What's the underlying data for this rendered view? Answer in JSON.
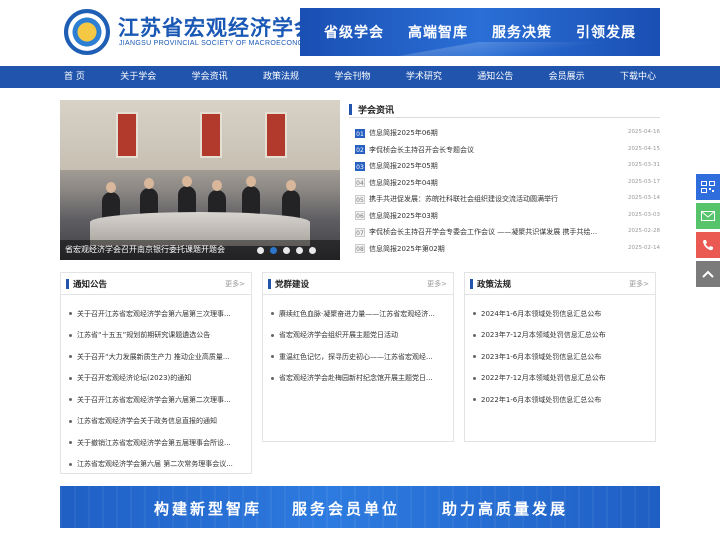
{
  "header": {
    "site_title": "江苏省宏观经济学会",
    "site_subtitle": "JIANGSU PROVINCIAL SOCIETY OF MACROECONOMICS",
    "emblem_text": "江苏省宏观经济学会",
    "slogans": [
      "省级学会",
      "高端智库",
      "服务决策",
      "引领发展"
    ]
  },
  "nav": {
    "items": [
      "首 页",
      "关于学会",
      "学会资讯",
      "政策法规",
      "学会刊物",
      "学术研究",
      "通知公告",
      "会员展示",
      "下载中心"
    ],
    "active_index": 0
  },
  "slider": {
    "caption": "省宏观经济学会召开南京银行委托课题开题会",
    "dot_count": 5,
    "active_dot": 1
  },
  "news": {
    "title": "学会资讯",
    "items": [
      {
        "num": "01",
        "text": "信息简报2025年06期",
        "date": "2025-04-16",
        "hot": true
      },
      {
        "num": "02",
        "text": "李侃桢会长主持召开会长专题会议",
        "date": "2025-04-15",
        "hot": true
      },
      {
        "num": "03",
        "text": "信息简报2025年05期",
        "date": "2025-03-31",
        "hot": true
      },
      {
        "num": "04",
        "text": "信息简报2025年04期",
        "date": "2025-03-17",
        "hot": false
      },
      {
        "num": "05",
        "text": "携手共进促发展：苏皖社科联社会组织建设交流活动圆满举行",
        "date": "2025-03-14",
        "hot": false
      },
      {
        "num": "06",
        "text": "信息简报2025年03期",
        "date": "2025-03-03",
        "hot": false
      },
      {
        "num": "07",
        "text": "李侃桢会长主持召开学会专委会工作会议 ——凝聚共识谋发展 携手共绘...",
        "date": "2025-02-28",
        "hot": false
      },
      {
        "num": "08",
        "text": "信息简报2025年第02期",
        "date": "2025-02-14",
        "hot": false
      }
    ]
  },
  "columns": {
    "notices": {
      "title": "通知公告",
      "more": "更多>",
      "items": [
        "关于召开江苏省宏观经济学会第六届第三次理事...",
        "江苏省“十五五”规划前期研究课题遴选公告",
        "关于召开“大力发展新质生产力 推动企业高质量...",
        "关于召开宏观经济论坛(2023)的通知",
        "关于召开江苏省宏观经济学会第六届第二次理事...",
        "江苏省宏观经济学会关于政务信息直报的通知",
        "关于撤销江苏省宏观经济学会第五届理事会所设...",
        "江苏省宏观经济学会第六届 第二次常务理事会议..."
      ]
    },
    "party": {
      "title": "党群建设",
      "more": "更多>",
      "items": [
        "赓续红色血脉·凝聚奋进力量——江苏省宏观经济...",
        "省宏观经济学会组织开展主题党日活动",
        "重温红色记忆，探寻历史初心——江苏省宏观经...",
        "省宏观经济学会赴梅园新村纪念馆开展主题党日..."
      ]
    },
    "policy": {
      "title": "政策法规",
      "more": "更多>",
      "items": [
        "2024年1-6月本领域处罚信息汇总公布",
        "2023年7-12月本领域处罚信息汇总公布",
        "2023年1-6月本领域处罚信息汇总公布",
        "2022年7-12月本领域处罚信息汇总公布",
        "2022年1-6月本领域处罚信息汇总公布"
      ]
    }
  },
  "bottom_banner": {
    "slogans": [
      "构建新型智库",
      "服务会员单位",
      "助力高质量发展"
    ]
  },
  "float_bar": {
    "icons": [
      "qrcode-icon",
      "mail-icon",
      "phone-icon",
      "back-to-top-icon"
    ]
  },
  "colors": {
    "brand": "#2155ad",
    "accent": "#2f7fe0",
    "bar_qr": "#2f6ddc",
    "bar_mail": "#57c36a",
    "bar_phone": "#ea5a52",
    "bar_top": "#7b7b7b"
  }
}
